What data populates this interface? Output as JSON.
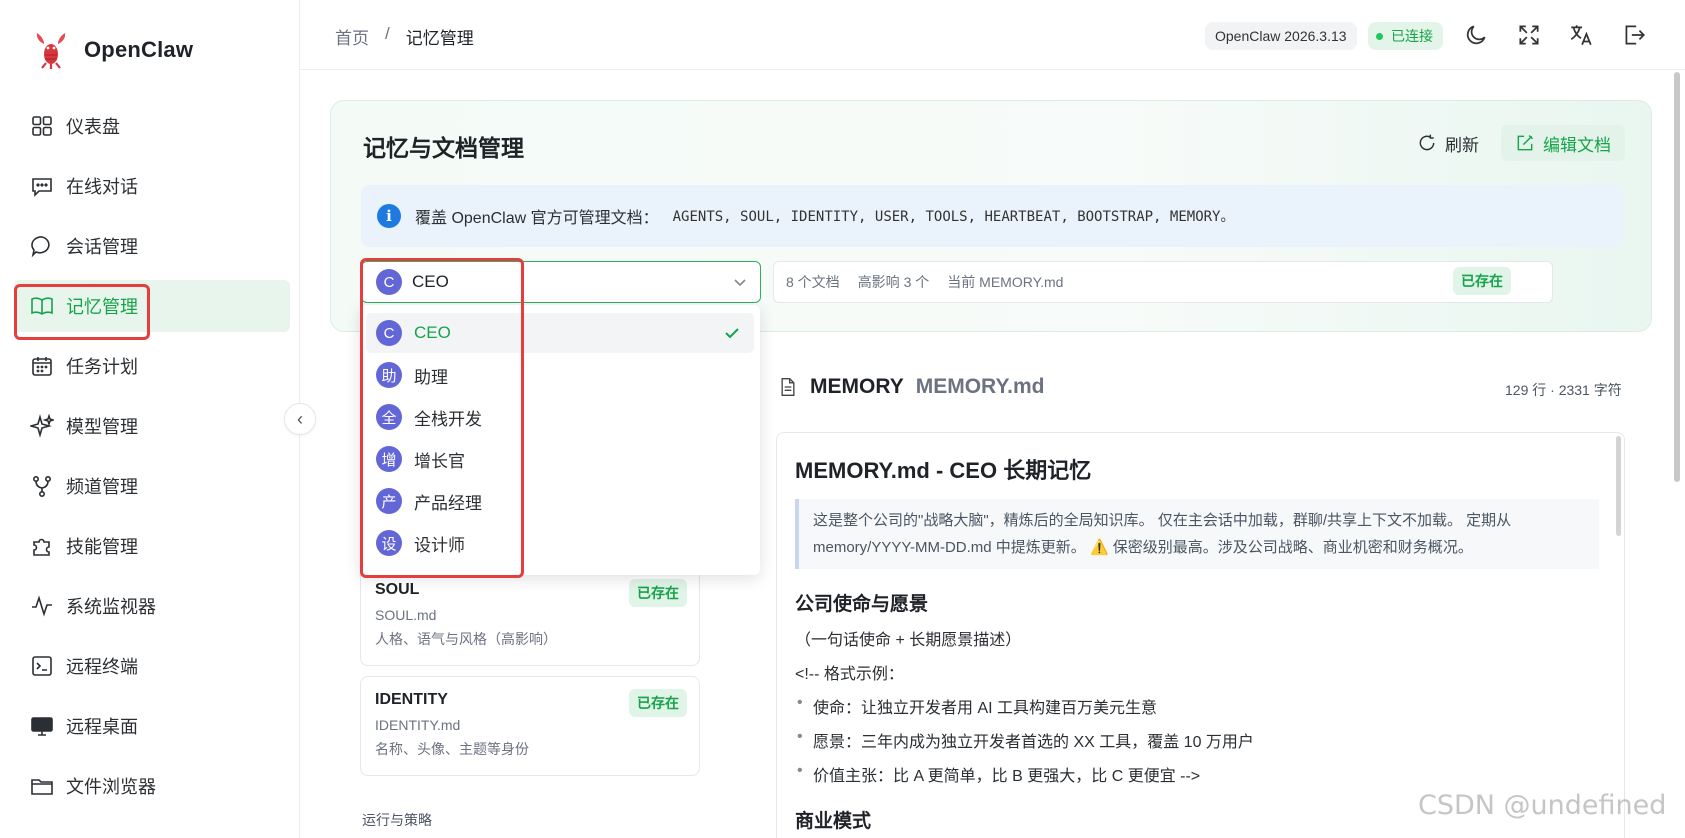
{
  "app": {
    "name": "OpenClaw"
  },
  "sidebar": {
    "items": [
      {
        "label": "仪表盘",
        "icon": "dashboard-icon"
      },
      {
        "label": "在线对话",
        "icon": "chat-icon"
      },
      {
        "label": "会话管理",
        "icon": "session-icon"
      },
      {
        "label": "记忆管理",
        "icon": "book-icon",
        "active": true
      },
      {
        "label": "任务计划",
        "icon": "calendar-icon"
      },
      {
        "label": "模型管理",
        "icon": "sparkle-icon"
      },
      {
        "label": "频道管理",
        "icon": "branch-icon"
      },
      {
        "label": "技能管理",
        "icon": "puzzle-icon"
      },
      {
        "label": "系统监视器",
        "icon": "pulse-icon"
      },
      {
        "label": "远程终端",
        "icon": "terminal-icon"
      },
      {
        "label": "远程桌面",
        "icon": "monitor-icon"
      },
      {
        "label": "文件浏览器",
        "icon": "folder-icon"
      }
    ]
  },
  "header": {
    "breadcrumb_home": "首页",
    "breadcrumb_sep": "/",
    "breadcrumb_current": "记忆管理",
    "version": "OpenClaw 2026.3.13",
    "status": "已连接"
  },
  "panel": {
    "title": "记忆与文档管理",
    "refresh_label": "刷新",
    "edit_label": "编辑文档",
    "info_prefix": "覆盖 OpenClaw 官方可管理文档：",
    "info_docs": "AGENTS, SOUL, IDENTITY, USER, TOOLS, HEARTBEAT, BOOTSTRAP, MEMORY。",
    "selected_agent": "CEO",
    "selected_avatar": "C",
    "meta_count": "8 个文档",
    "meta_high": "高影响 3 个",
    "meta_current": "当前 MEMORY.md",
    "exists": "已存在"
  },
  "dropdown": {
    "options": [
      {
        "avatar": "C",
        "label": "CEO",
        "selected": true
      },
      {
        "avatar": "助",
        "label": "助理"
      },
      {
        "avatar": "全",
        "label": "全栈开发"
      },
      {
        "avatar": "增",
        "label": "增长官"
      },
      {
        "avatar": "产",
        "label": "产品经理"
      },
      {
        "avatar": "设",
        "label": "设计师"
      }
    ]
  },
  "doc_list": [
    {
      "name": "SOUL",
      "file": "SOUL.md",
      "desc": "人格、语气与风格（高影响）",
      "status": "已存在"
    },
    {
      "name": "IDENTITY",
      "file": "IDENTITY.md",
      "desc": "名称、头像、主题等身份",
      "status": "已存在"
    }
  ],
  "doc_list_section": "运行与策略",
  "document": {
    "title": "MEMORY",
    "file": "MEMORY.md",
    "stats": "129 行 · 2331 字符",
    "h1": "MEMORY.md - CEO 长期记忆",
    "quote_line1": "这是整个公司的\"战略大脑\"，精炼后的全局知识库。 仅在主会话中加载，群聊/共享上下文不加载。 定期从",
    "quote_line2": "memory/YYYY-MM-DD.md 中提炼更新。 ⚠️ 保密级别最高。涉及公司战略、商业机密和财务概况。",
    "h2_1": "公司使命与愿景",
    "p1": "（一句话使命 + 长期愿景描述）",
    "p2": "<!-- 格式示例：",
    "li1": "使命：让独立开发者用 AI 工具构建百万美元生意",
    "li2": "愿景：三年内成为独立开发者首选的 XX 工具，覆盖 10 万用户",
    "li3": "价值主张：比 A 更简单，比 B 更强大，比 C 更便宜 -->",
    "h2_2": "商业模式"
  },
  "watermark": "CSDN @undefined",
  "colors": {
    "accent": "#16a34a",
    "highlight": "#e53e3e",
    "avatar": "#6366d6"
  }
}
